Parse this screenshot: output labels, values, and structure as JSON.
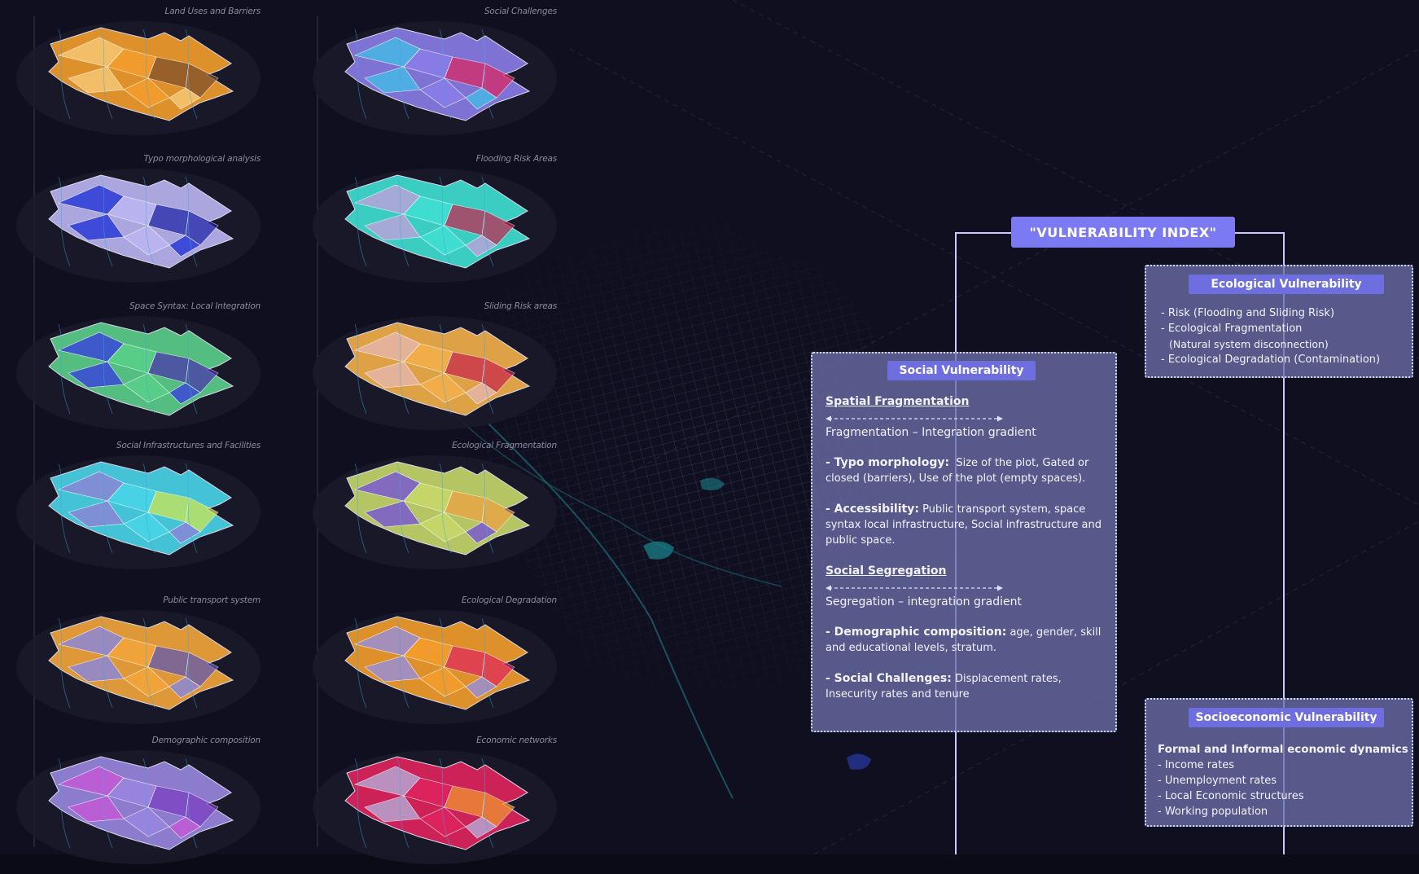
{
  "thumbnails": [
    {
      "label": "Land Uses and Barriers",
      "icon": "land-use-map",
      "palette": [
        "#f6c873",
        "#f49d2c",
        "#7a4c2c"
      ]
    },
    {
      "label": "Social Challenges",
      "icon": "social-challenges-map",
      "palette": [
        "#47b8e6",
        "#8a7de8",
        "#e0245e"
      ]
    },
    {
      "label": "Typo morphological analysis",
      "icon": "typo-morphology-map",
      "palette": [
        "#2c3ad8",
        "#bcb7f2",
        "#1c1fa6"
      ]
    },
    {
      "label": "Flooding Risk Areas",
      "icon": "flooding-risk-map",
      "palette": [
        "#b7a3d9",
        "#3fe0d3",
        "#c8214b"
      ]
    },
    {
      "label": "Space Syntax: Local Integration",
      "icon": "space-syntax-map",
      "palette": [
        "#3b48d8",
        "#5ad08a",
        "#4a2fb0"
      ]
    },
    {
      "label": "Sliding Risk areas",
      "icon": "sliding-risk-map",
      "palette": [
        "#e6b6a8",
        "#f4b04a",
        "#c8214b"
      ]
    },
    {
      "label": "Social Infrastructures and Facilities",
      "icon": "social-infrastructure-map",
      "palette": [
        "#8a86d6",
        "#48d6e8",
        "#d6e84a"
      ]
    },
    {
      "label": "Ecological Fragmentation",
      "icon": "ecological-fragmentation-map",
      "palette": [
        "#7a5cd0",
        "#c8d86a",
        "#f0a040"
      ]
    },
    {
      "label": "Public transport system",
      "icon": "public-transport-map",
      "palette": [
        "#8c87d6",
        "#f4a63a",
        "#5a55b8"
      ]
    },
    {
      "label": "Ecological Degradation",
      "icon": "ecological-degradation-map",
      "palette": [
        "#9b8ed4",
        "#f49d2c",
        "#e0245e"
      ]
    },
    {
      "label": "Demographic composition",
      "icon": "demographic-map",
      "palette": [
        "#c45ad8",
        "#9a86e0",
        "#7a3cc0"
      ]
    },
    {
      "label": "Economic networks",
      "icon": "economic-networks-map",
      "palette": [
        "#b8a4d0",
        "#e0245e",
        "#f49d2c"
      ]
    }
  ],
  "diagram": {
    "title": "\"VULNERABILITY INDEX\"",
    "ecological": {
      "heading": "Ecological Vulnerability",
      "items": [
        {
          "main": "- Risk ",
          "detail": "(Flooding and Sliding Risk)"
        },
        {
          "main": "- Ecological Fragmentation",
          "detail": ""
        },
        {
          "main": "",
          "detail": "(Natural system disconnection)"
        },
        {
          "main": "- Ecological Degradation ",
          "detail": "(Contamination)"
        }
      ]
    },
    "social": {
      "heading": "Social Vulnerability",
      "spatial": {
        "title": "Spatial Fragmentation",
        "gradient": "Fragmentation – Integration gradient",
        "points": [
          {
            "key": "- Typo morphology:",
            "text": "Size of the plot, Gated or closed (barriers), Use of the plot (empty spaces)."
          },
          {
            "key": "- Accessibility:",
            "text": "Public transport system, space syntax local infrastructure, Social infrastructure and public space."
          }
        ]
      },
      "segregation": {
        "title": "Social Segregation",
        "gradient": "Segregation – integration gradient",
        "points": [
          {
            "key": "- Demographic composition:",
            "text": "age, gender, skill and educational levels, stratum."
          },
          {
            "key": "- Social Challenges:",
            "text": "Displacement rates, Insecurity rates and tenure"
          }
        ]
      }
    },
    "socioeconomic": {
      "heading": "Socioeconomic Vulnerability",
      "lead": "Formal and Informal economic dynamics",
      "items": [
        "- Income rates",
        "- Unemployment rates",
        "- Local Economic structures",
        "- Working population"
      ]
    },
    "colors": {
      "accent": "#7c7af2",
      "panel": "#6c6eaa",
      "line": "#c9c9ff",
      "background": "#0b0b18"
    }
  }
}
